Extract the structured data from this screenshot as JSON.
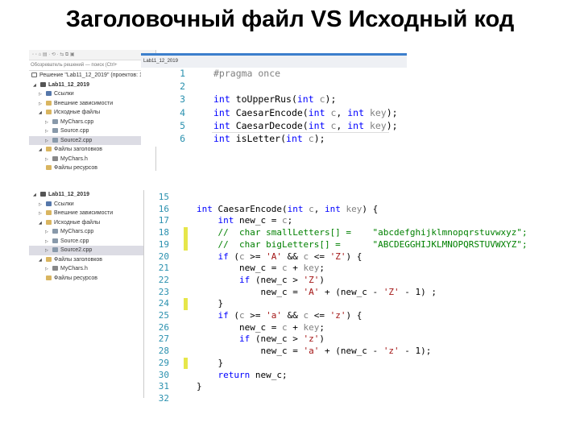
{
  "title": "Заголовочный файл VS Исходный код",
  "colors": {
    "keyword": "#0000ff",
    "param": "#808080",
    "string": "#a31515",
    "comment": "#008000",
    "line_number": "#2b91af",
    "change_marker": "#e6e64a"
  },
  "explorer_top": {
    "search_placeholder": "Обозреватель решений — поиск (Ctrl+",
    "solution": "Решение \"Lab11_12_2019\" (проектов: 1",
    "items": [
      {
        "label": "Lab11_12_2019",
        "bold": true
      },
      {
        "label": "Ссылки"
      },
      {
        "label": "Внешние зависимости"
      },
      {
        "label": "Исходные файлы"
      },
      {
        "label": "MyChars.cpp"
      },
      {
        "label": "Source.cpp"
      },
      {
        "label": "Source2.cpp",
        "selected": true
      },
      {
        "label": "Файлы заголовков"
      },
      {
        "label": "MyChars.h"
      },
      {
        "label": "Файлы ресурсов"
      }
    ]
  },
  "explorer_bottom": {
    "items": [
      {
        "label": "Lab11_12_2019",
        "bold": true
      },
      {
        "label": "Ссылки"
      },
      {
        "label": "Внешние зависимости"
      },
      {
        "label": "Исходные файлы"
      },
      {
        "label": "MyChars.cpp"
      },
      {
        "label": "Source.cpp"
      },
      {
        "label": "Source2.cpp",
        "selected": true
      },
      {
        "label": "Файлы заголовков"
      },
      {
        "label": "MyChars.h"
      },
      {
        "label": "Файлы ресурсов"
      }
    ]
  },
  "header_editor": {
    "project_dropdown": "Lab11_12_2019",
    "lines": [
      {
        "n": "1",
        "t": [
          [
            "#pragma once",
            "pp"
          ]
        ]
      },
      {
        "n": "2",
        "t": []
      },
      {
        "n": "3",
        "t": [
          [
            "int",
            "kw"
          ],
          [
            " toUpperRus(",
            "tx"
          ],
          [
            "int",
            "kw"
          ],
          [
            " ",
            "tx"
          ],
          [
            "c",
            "pr"
          ],
          [
            ");",
            "tx"
          ]
        ]
      },
      {
        "n": "4",
        "t": [
          [
            "int",
            "kw"
          ],
          [
            " CaesarEncode(",
            "tx"
          ],
          [
            "int",
            "kw"
          ],
          [
            " ",
            "tx"
          ],
          [
            "c",
            "pr"
          ],
          [
            ", ",
            "tx"
          ],
          [
            "int",
            "kw"
          ],
          [
            " ",
            "tx"
          ],
          [
            "key",
            "pr"
          ],
          [
            ");",
            "tx"
          ]
        ]
      },
      {
        "n": "5",
        "t": [
          [
            "int",
            "kw"
          ],
          [
            " CaesarDecode(",
            "tx"
          ],
          [
            "int",
            "kw"
          ],
          [
            " ",
            "tx"
          ],
          [
            "c",
            "pr"
          ],
          [
            ", ",
            "tx"
          ],
          [
            "int",
            "kw"
          ],
          [
            " ",
            "tx"
          ],
          [
            "key",
            "pr"
          ],
          [
            ");",
            "tx"
          ]
        ]
      },
      {
        "n": "6",
        "t": [
          [
            "int",
            "kw"
          ],
          [
            " isLetter(",
            "tx"
          ],
          [
            "int",
            "kw"
          ],
          [
            " ",
            "tx"
          ],
          [
            "c",
            "pr"
          ],
          [
            ");",
            "tx"
          ]
        ]
      }
    ]
  },
  "source_editor": {
    "lines": [
      {
        "n": "15",
        "t": []
      },
      {
        "n": "16",
        "t": [
          [
            "int",
            "kw"
          ],
          [
            " CaesarEncode(",
            "tx"
          ],
          [
            "int",
            "kw"
          ],
          [
            " ",
            "tx"
          ],
          [
            "c",
            "pr"
          ],
          [
            ", ",
            "tx"
          ],
          [
            "int",
            "kw"
          ],
          [
            " ",
            "tx"
          ],
          [
            "key",
            "pr"
          ],
          [
            ") {",
            "tx"
          ]
        ]
      },
      {
        "n": "17",
        "t": [
          [
            "    ",
            "tx"
          ],
          [
            "int",
            "kw"
          ],
          [
            " new_c = ",
            "tx"
          ],
          [
            "c",
            "pr"
          ],
          [
            ";",
            "tx"
          ]
        ]
      },
      {
        "n": "18",
        "t": [
          [
            "    //  char smallLetters[] =    \"abcdefghijklmnopqrstuvwxyz\";",
            "cm"
          ]
        ]
      },
      {
        "n": "19",
        "t": [
          [
            "    //  char bigLetters[] =      \"ABCDEGGHIJKLMNOPQRSTUVWXYZ\";",
            "cm"
          ]
        ]
      },
      {
        "n": "20",
        "t": [
          [
            "    ",
            "tx"
          ],
          [
            "if",
            "kw"
          ],
          [
            " (",
            "tx"
          ],
          [
            "c",
            "pr"
          ],
          [
            " >= ",
            "tx"
          ],
          [
            "'A'",
            "st"
          ],
          [
            " && ",
            "tx"
          ],
          [
            "c",
            "pr"
          ],
          [
            " <= ",
            "tx"
          ],
          [
            "'Z'",
            "st"
          ],
          [
            ") {",
            "tx"
          ]
        ]
      },
      {
        "n": "21",
        "t": [
          [
            "        new_c = ",
            "tx"
          ],
          [
            "c",
            "pr"
          ],
          [
            " + ",
            "tx"
          ],
          [
            "key",
            "pr"
          ],
          [
            ";",
            "tx"
          ]
        ]
      },
      {
        "n": "22",
        "t": [
          [
            "        ",
            "tx"
          ],
          [
            "if",
            "kw"
          ],
          [
            " (new_c > ",
            "tx"
          ],
          [
            "'Z'",
            "st"
          ],
          [
            ")",
            "tx"
          ]
        ]
      },
      {
        "n": "23",
        "t": [
          [
            "            new_c = ",
            "tx"
          ],
          [
            "'A'",
            "st"
          ],
          [
            " + (new_c - ",
            "tx"
          ],
          [
            "'Z'",
            "st"
          ],
          [
            " - 1) ;",
            "tx"
          ]
        ]
      },
      {
        "n": "24",
        "t": [
          [
            "    }",
            "tx"
          ]
        ]
      },
      {
        "n": "25",
        "t": [
          [
            "    ",
            "tx"
          ],
          [
            "if",
            "kw"
          ],
          [
            " (",
            "tx"
          ],
          [
            "c",
            "pr"
          ],
          [
            " >= ",
            "tx"
          ],
          [
            "'a'",
            "st"
          ],
          [
            " && ",
            "tx"
          ],
          [
            "c",
            "pr"
          ],
          [
            " <= ",
            "tx"
          ],
          [
            "'z'",
            "st"
          ],
          [
            ") {",
            "tx"
          ]
        ]
      },
      {
        "n": "26",
        "t": [
          [
            "        new_c = ",
            "tx"
          ],
          [
            "c",
            "pr"
          ],
          [
            " + ",
            "tx"
          ],
          [
            "key",
            "pr"
          ],
          [
            ";",
            "tx"
          ]
        ]
      },
      {
        "n": "27",
        "t": [
          [
            "        ",
            "tx"
          ],
          [
            "if",
            "kw"
          ],
          [
            " (new_c > ",
            "tx"
          ],
          [
            "'z'",
            "st"
          ],
          [
            ")",
            "tx"
          ]
        ]
      },
      {
        "n": "28",
        "t": [
          [
            "            new_c = ",
            "tx"
          ],
          [
            "'a'",
            "st"
          ],
          [
            " + (new_c - ",
            "tx"
          ],
          [
            "'z'",
            "st"
          ],
          [
            " - 1);",
            "tx"
          ]
        ]
      },
      {
        "n": "29",
        "t": [
          [
            "    }",
            "tx"
          ]
        ]
      },
      {
        "n": "30",
        "t": [
          [
            "    ",
            "tx"
          ],
          [
            "return",
            "kw"
          ],
          [
            " new_c;",
            "tx"
          ]
        ]
      },
      {
        "n": "31",
        "t": [
          [
            "}",
            "tx"
          ]
        ]
      },
      {
        "n": "32",
        "t": []
      }
    ]
  }
}
